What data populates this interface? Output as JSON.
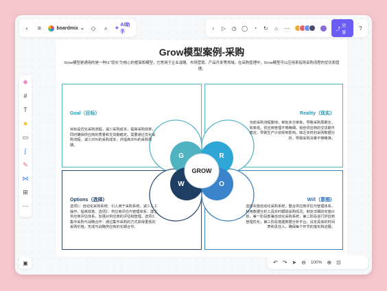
{
  "toolbar": {
    "brand": "boardmix",
    "brand_caret": "⌄",
    "ai_label": "AI助手",
    "share_label": "分享",
    "help_icon": "?"
  },
  "document": {
    "title": "Grow模型案例-采购",
    "intro": "Grow模型是通用的是一种以“增长”为核心的框架和模型，它常用于企业战略、市场营销、产品开发等领域。在采购管理中，Grow模型可以应用来指导采购流程的优化和管理。",
    "center": "GROW",
    "quadrants": {
      "g": {
        "letter": "G",
        "heading": "Goal（目标）",
        "text": "目标是优化采购流程，减少采购成本，提高采购效率，同时确保供应商的质量和交货期稳定。需要通过优化采购流程，减少20%的采购成本，并提高30%的采购周期。"
      },
      "r": {
        "letter": "R",
        "heading": "Reality（现实）",
        "text": "当前采购流程繁琐，审批多次审批，导致采购周期长，效率低。供应商管理不够精细，有些供应商的交货期不稳定，导致生产计划受到影响。缺乏实时的采购数据分析，导致采购决策不够精准。"
      },
      "w": {
        "letter": "W",
        "heading": "Options（选择）",
        "text": "选项1：自动化采购系统：引入用于采购系统，减少人工操作，提高效率。选项2：供应商评估与管理体系：建立供应商评估体系，加强对供应商的评估和管理。选项3：集中采购与战略合作：通过集中采购的方式获得更低的采购价格，形成与战略供应商的长期合作。"
      },
      "o": {
        "letter": "O",
        "heading": "Will（意图）",
        "text": "选择实施自动化采购系统，整合供应商评估与管理体系，利用数据分析工具实时跟踪采购情况。制定详细的实施计划，第一阶段部署自动化采购系统，第二阶段进行供应商管理优化，第三阶段搭建数据分析平台。设定具体的时间表和责任人，确保每个环节的落实和进展。"
      }
    }
  },
  "zoom": {
    "level": "100%"
  },
  "colors": {
    "g": "#4fb3c2",
    "r": "#2ea7d6",
    "w": "#1e3f63",
    "o": "#3a84cc",
    "heading_g": "#2a9aaf",
    "heading_r": "#2a9aaf",
    "heading_w": "#1e3f63",
    "heading_o": "#2e6fb0"
  }
}
